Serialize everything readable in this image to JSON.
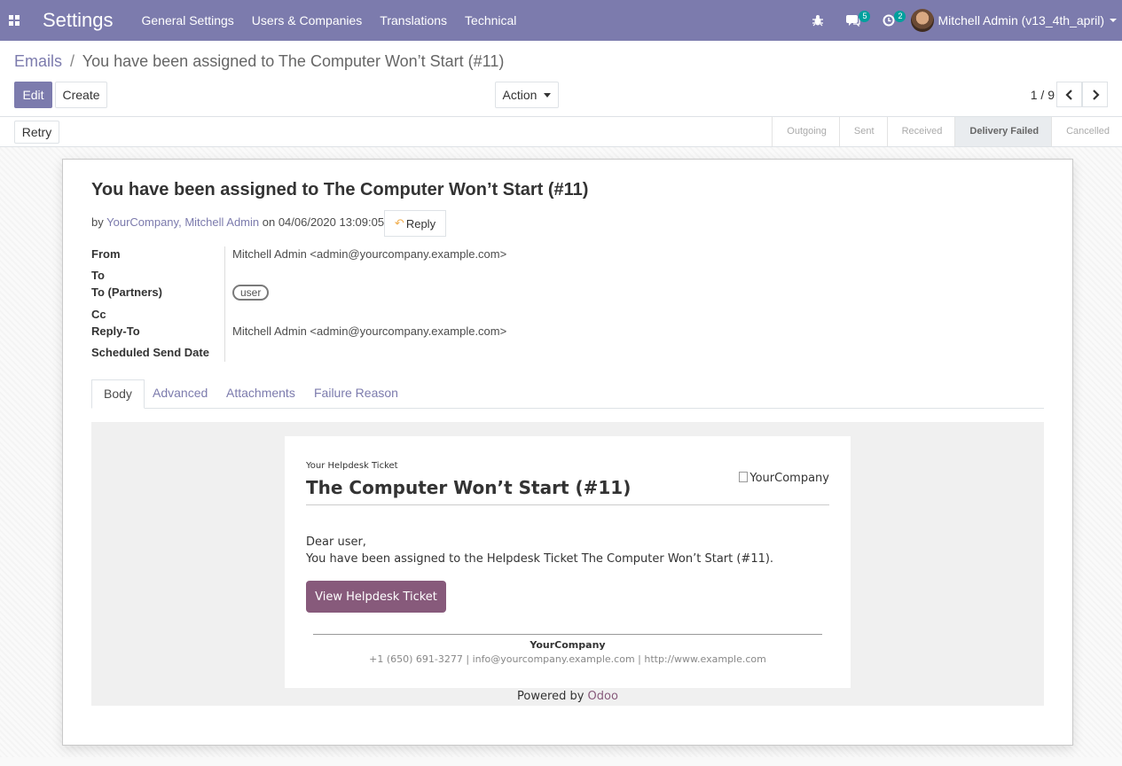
{
  "navbar": {
    "app_title": "Settings",
    "menu": [
      "General Settings",
      "Users & Companies",
      "Translations",
      "Technical"
    ],
    "messages_badge": "5",
    "activities_badge": "2",
    "user_name": "Mitchell Admin (v13_4th_april)"
  },
  "breadcrumb": {
    "parent": "Emails",
    "separator": "/",
    "current": "You have been assigned to The Computer Won’t Start (#11)"
  },
  "buttons": {
    "edit": "Edit",
    "create": "Create",
    "action": "Action",
    "retry": "Retry"
  },
  "pager": {
    "value": "1 / 9"
  },
  "stages": [
    "Outgoing",
    "Sent",
    "Received",
    "Delivery Failed",
    "Cancelled"
  ],
  "active_stage": "Delivery Failed",
  "message": {
    "subject": "You have been assigned to The Computer Won’t Start (#11)",
    "by_prefix": "by",
    "author_company": "YourCompany",
    "author_sep": ", ",
    "author_name": "Mitchell Admin",
    "on_text": " on ",
    "date": "04/06/2020 13:09:05",
    "reply_label": "Reply"
  },
  "fields": {
    "from_label": "From",
    "from_value": "Mitchell Admin <admin@yourcompany.example.com>",
    "to_label": "To",
    "to_partners_label": "To (Partners)",
    "to_partners_tag": "user",
    "cc_label": "Cc",
    "reply_to_label": "Reply-To",
    "reply_to_value": "Mitchell Admin <admin@yourcompany.example.com>",
    "scheduled_label": "Scheduled Send Date"
  },
  "tabs": [
    "Body",
    "Advanced",
    "Attachments",
    "Failure Reason"
  ],
  "email": {
    "kicker": "Your Helpdesk Ticket",
    "title": "The Computer Won’t Start (#11)",
    "logo_alt": "YourCompany",
    "greeting": "Dear user,",
    "body": "You have been assigned to the Helpdesk Ticket The Computer Won’t Start (#11).",
    "button": "View Helpdesk Ticket",
    "footer_company": "YourCompany",
    "footer_contact": "+1 (650) 691-3277 | info@yourcompany.example.com | http://www.example.com",
    "powered_prefix": "Powered by ",
    "powered_brand": "Odoo"
  },
  "colors": {
    "navbar": "#7c7bad",
    "primary": "#7c7bad",
    "email_button": "#875a7b",
    "badge": "#00a09d"
  }
}
